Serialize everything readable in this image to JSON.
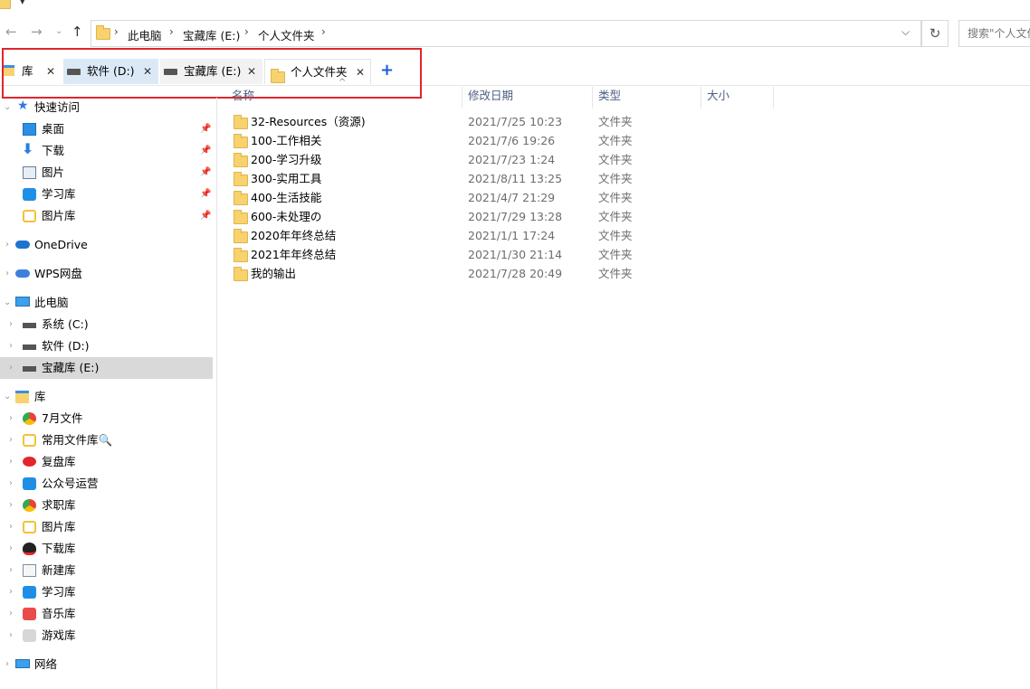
{
  "address": {
    "crumbs": [
      "此电脑",
      "宝藏库 (E:)",
      "个人文件夹"
    ],
    "search_placeholder": "搜索\"个人文件夹\""
  },
  "tabs": [
    {
      "label": "库",
      "icon": "library-icon"
    },
    {
      "label": "软件 (D:)",
      "icon": "drive-icon",
      "active": false
    },
    {
      "label": "宝藏库 (E:)",
      "icon": "drive-icon"
    },
    {
      "label": "个人文件夹",
      "icon": "folder-icon",
      "active": true
    }
  ],
  "columns": {
    "name": "名称",
    "modified": "修改日期",
    "type": "类型",
    "size": "大小"
  },
  "files": [
    {
      "name": "32-Resources（资源)",
      "modified": "2021/7/25 10:23",
      "type": "文件夹"
    },
    {
      "name": "100-工作相关",
      "modified": "2021/7/6 19:26",
      "type": "文件夹"
    },
    {
      "name": "200-学习升级",
      "modified": "2021/7/23 1:24",
      "type": "文件夹"
    },
    {
      "name": "300-实用工具",
      "modified": "2021/8/11 13:25",
      "type": "文件夹"
    },
    {
      "name": "400-生活技能",
      "modified": "2021/4/7 21:29",
      "type": "文件夹"
    },
    {
      "name": "600-未处理の",
      "modified": "2021/7/29 13:28",
      "type": "文件夹"
    },
    {
      "name": "2020年年终总结",
      "modified": "2021/1/1 17:24",
      "type": "文件夹"
    },
    {
      "name": "2021年年终总结",
      "modified": "2021/1/30 21:14",
      "type": "文件夹"
    },
    {
      "name": "我的输出",
      "modified": "2021/7/28 20:49",
      "type": "文件夹"
    }
  ],
  "sidebar": {
    "quick_access": {
      "label": "快速访问",
      "items": [
        "桌面",
        "下载",
        "图片",
        "学习库",
        "图片库"
      ]
    },
    "onedrive": "OneDrive",
    "wps": "WPS网盘",
    "this_pc": {
      "label": "此电脑",
      "items": [
        "系统 (C:)",
        "软件 (D:)",
        "宝藏库 (E:)"
      ]
    },
    "libraries": {
      "label": "库",
      "items": [
        "7月文件",
        "常用文件库🔍",
        "复盘库",
        "公众号运营",
        "求职库",
        "图片库",
        "下载库",
        "新建库",
        "学习库",
        "音乐库",
        "游戏库"
      ]
    },
    "network": "网络"
  },
  "colors": {
    "accent": "#0078d7",
    "highlight_box": "#e0262b",
    "selected": "#d9d9d9",
    "header_text": "#4d6082"
  }
}
